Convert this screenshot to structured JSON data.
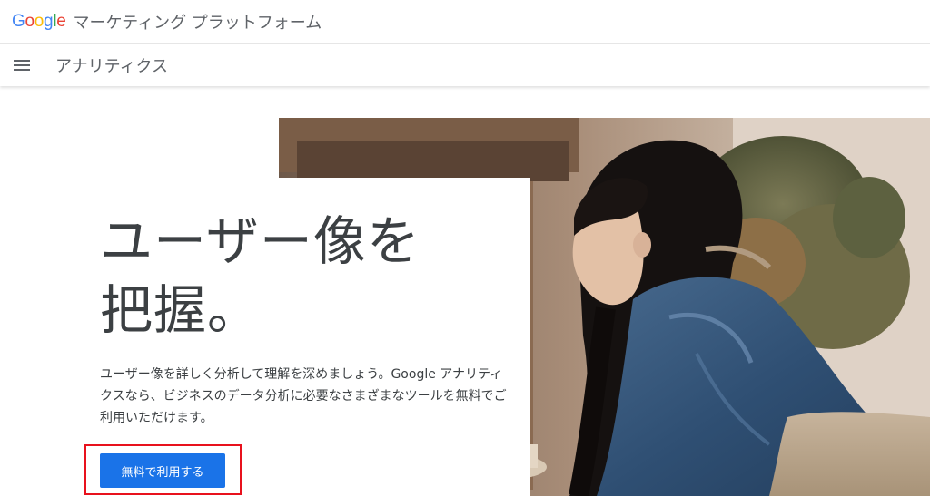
{
  "brand": {
    "logo_letters": [
      "G",
      "o",
      "o",
      "g",
      "l",
      "e"
    ],
    "logo_colors": [
      "#4285F4",
      "#EA4335",
      "#FBBC05",
      "#4285F4",
      "#34A853",
      "#EA4335"
    ],
    "platform_name": "マーケティング プラットフォーム"
  },
  "nav": {
    "menu_icon": "hamburger-menu-icon",
    "product_name": "アナリティクス"
  },
  "hero": {
    "headline_line1": "ユーザー像を",
    "headline_line2": "把握。",
    "description": "ユーザー像を詳しく分析して理解を深めましょう。Google アナリティクスなら、ビジネスのデータ分析に必要なさまざまなツールを無料でご利用いただけます。",
    "cta_label": "無料で利用する",
    "photo": "woman-in-denim-shirt-photo"
  },
  "colors": {
    "cta_blue": "#1a73e8",
    "highlight_red": "#e8111d",
    "text_dark": "#3c4043",
    "text_gray": "#5f6368"
  }
}
